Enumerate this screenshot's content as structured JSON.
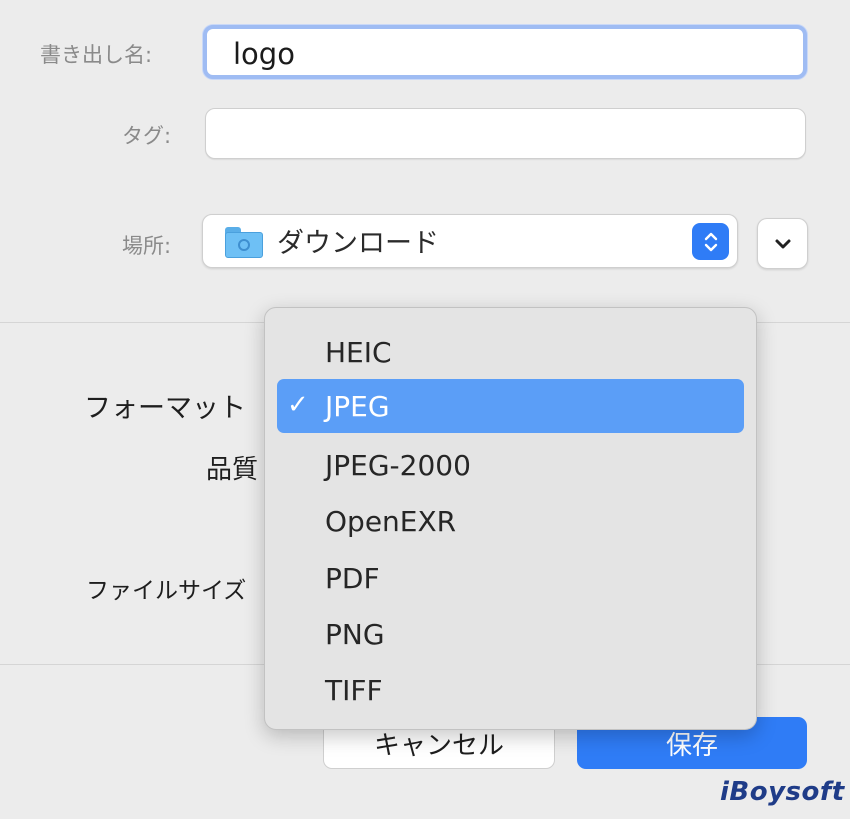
{
  "form": {
    "name_label": "書き出し名:",
    "name_value": "logo",
    "tags_label": "タグ:",
    "tags_value": "",
    "location_label": "場所:",
    "location_value": "ダウンロード",
    "format_label": "フォーマット",
    "quality_label": "品質",
    "filesize_label": "ファイルサイズ"
  },
  "icons": {
    "location_folder": "folder-icon",
    "location_stepper": "stepper-updown-icon",
    "expand": "chevron-down-icon",
    "check": "checkmark-icon"
  },
  "buttons": {
    "cancel_label": "キャンセル",
    "save_label": "保存"
  },
  "format_menu": {
    "items": [
      {
        "label": "HEIC",
        "selected": false
      },
      {
        "label": "JPEG",
        "selected": true
      },
      {
        "label": "JPEG-2000",
        "selected": false
      },
      {
        "label": "OpenEXR",
        "selected": false
      },
      {
        "label": "PDF",
        "selected": false
      },
      {
        "label": "PNG",
        "selected": false
      },
      {
        "label": "TIFF",
        "selected": false
      }
    ],
    "check_glyph": "✓"
  },
  "colors": {
    "accent": "#2f7cf6",
    "menu_selection": "#5b9ef7",
    "focus_ring": "#9fbcf3",
    "watermark": "#1f3c88"
  },
  "watermark": "iBoysoft"
}
